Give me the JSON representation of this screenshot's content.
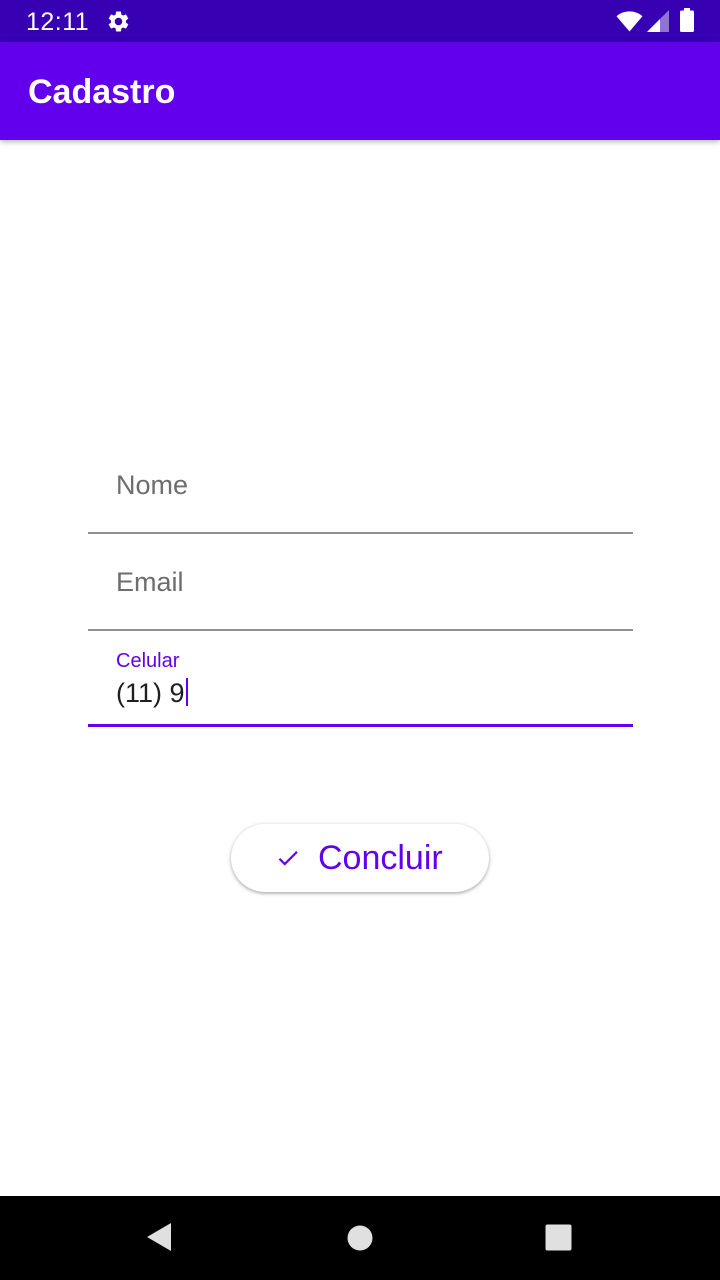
{
  "status_bar": {
    "time": "12:11",
    "icons": [
      "gear-icon",
      "wifi-icon",
      "signal-icon",
      "battery-icon"
    ]
  },
  "app_bar": {
    "title": "Cadastro"
  },
  "form": {
    "nome": {
      "placeholder": "Nome",
      "value": ""
    },
    "email": {
      "placeholder": "Email",
      "value": ""
    },
    "celular": {
      "label": "Celular",
      "value": "(11) 9",
      "focused": true
    }
  },
  "submit_button": {
    "label": "Concluir",
    "icon": "check-icon"
  },
  "nav_bar": {
    "icons": [
      "back-icon",
      "home-icon",
      "recent-apps-icon"
    ]
  },
  "colors": {
    "primary": "#6200ee",
    "primary_dark": "#3700b3",
    "background": "#ffffff"
  }
}
